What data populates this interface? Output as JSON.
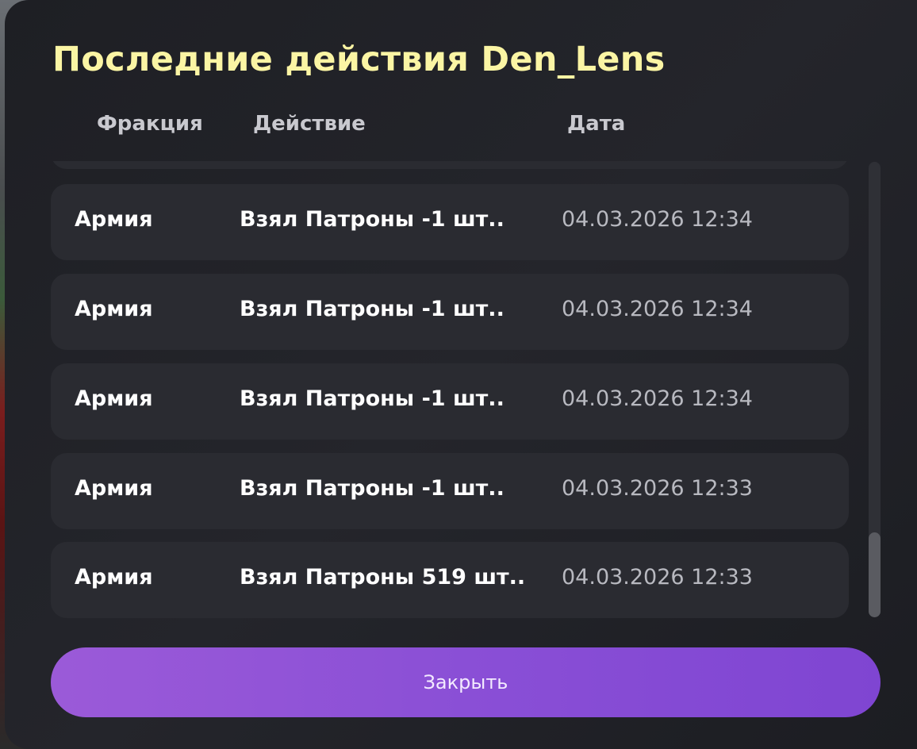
{
  "panel": {
    "title": "Последние действия Den_Lens"
  },
  "columns": {
    "faction": "Фракция",
    "action": "Действие",
    "date": "Дата"
  },
  "rows": [
    {
      "faction": "Армия",
      "action": "Взял Патроны -1 шт..",
      "date": "04.03.2026 12:34"
    },
    {
      "faction": "Армия",
      "action": "Взял Патроны -1 шт..",
      "date": "04.03.2026 12:34"
    },
    {
      "faction": "Армия",
      "action": "Взял Патроны -1 шт..",
      "date": "04.03.2026 12:34"
    },
    {
      "faction": "Армия",
      "action": "Взял Патроны -1 шт..",
      "date": "04.03.2026 12:33"
    },
    {
      "faction": "Армия",
      "action": "Взял Патроны 519 шт..",
      "date": "04.03.2026 12:33"
    }
  ],
  "close_button": {
    "label": "Закрыть"
  },
  "colors": {
    "title": "#fbf5a4",
    "panel_bg": "#1e1f24",
    "row_bg": "#2a2b31",
    "button_accent": "#8a4fd6"
  }
}
